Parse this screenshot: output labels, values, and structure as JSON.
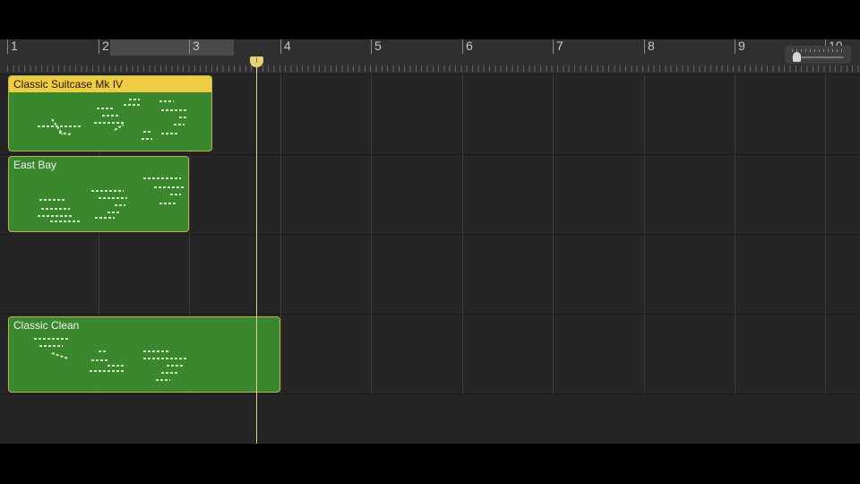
{
  "ruler": {
    "bars": [
      "1",
      "2",
      "3",
      "4",
      "5",
      "6",
      "7",
      "8",
      "9",
      "10"
    ]
  },
  "regions": [
    {
      "name": "Classic Suitcase Mk IV",
      "selected": true
    },
    {
      "name": "East Bay",
      "selected": false
    },
    {
      "name": "Classic Clean",
      "selected": false
    }
  ],
  "colors": {
    "region_fill": "#3b872e",
    "region_selected_header": "#f0cc43",
    "playhead": "#ddd08a"
  },
  "icons": {
    "playhead": "playhead-icon",
    "zoom": "zoom-slider-icon"
  }
}
